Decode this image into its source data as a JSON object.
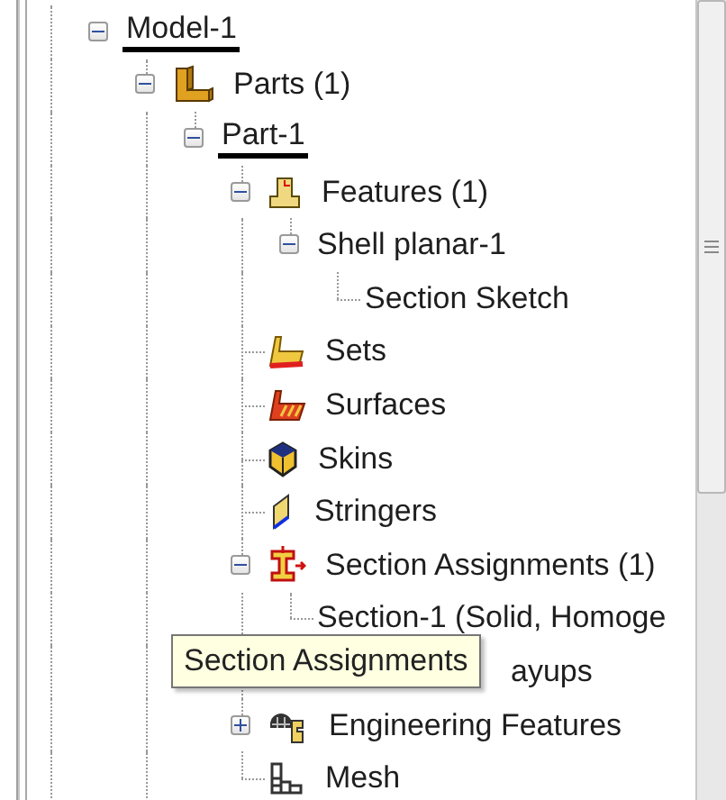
{
  "tree": [
    {
      "label": "Model-1",
      "current": true,
      "expanded": true,
      "children": [
        {
          "label": "Parts (1)",
          "kind": "part",
          "current": false,
          "expanded": true,
          "children": [
            {
              "label": "Part-1",
              "current": true,
              "expanded": true,
              "children": [
                {
                  "label": "Features (1)",
                  "kind": "feature",
                  "current": false,
                  "expanded": true,
                  "children": [
                    {
                      "label": "Shell planar-1",
                      "current": false,
                      "expanded": true,
                      "children": [
                        {
                          "label": "Section Sketch",
                          "current": false
                        }
                      ]
                    }
                  ]
                },
                {
                  "label": "Sets",
                  "kind": "sets",
                  "current": false
                },
                {
                  "label": "Surfaces",
                  "kind": "surfaces",
                  "current": false
                },
                {
                  "label": "Skins",
                  "kind": "skins",
                  "current": false
                },
                {
                  "label": "Stringers",
                  "kind": "stringers",
                  "current": false
                },
                {
                  "label": "Section Assignments (1)",
                  "kind": "section",
                  "current": false,
                  "expanded": true,
                  "children": [
                    {
                      "label": "Section-1 (Solid, Homoge",
                      "current": false
                    }
                  ]
                },
                {
                  "label": "ayups",
                  "kind": "covered",
                  "current": false
                },
                {
                  "label": "Engineering Features",
                  "kind": "engineering",
                  "current": false,
                  "expanded": false
                },
                {
                  "label": "Mesh",
                  "kind": "mesh",
                  "current": false
                }
              ]
            }
          ]
        }
      ]
    }
  ],
  "tooltip": {
    "text": "Section Assignments"
  }
}
